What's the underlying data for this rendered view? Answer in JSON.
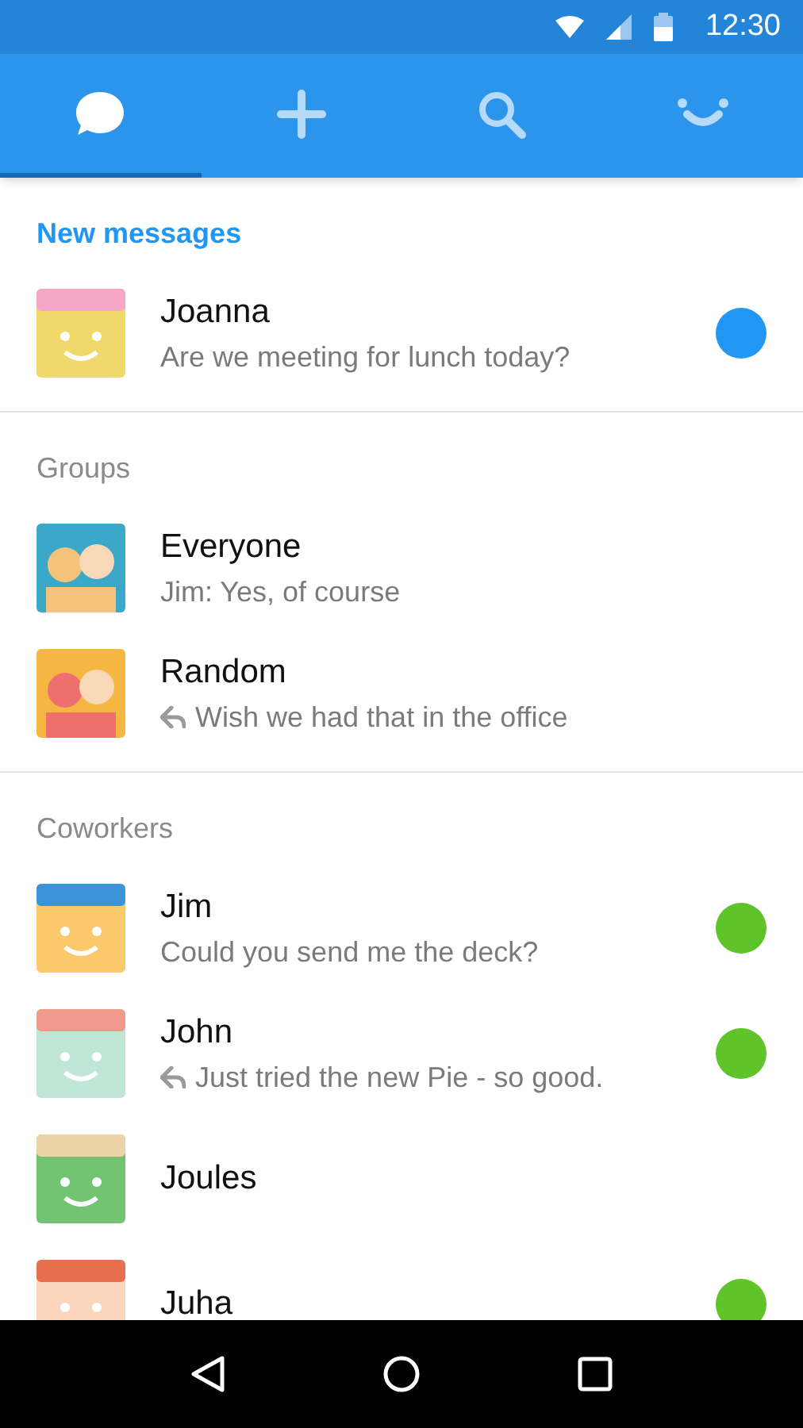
{
  "status_bar": {
    "time": "12:30"
  },
  "tabs": [
    {
      "kind": "chat",
      "selected": true
    },
    {
      "kind": "add",
      "selected": false
    },
    {
      "kind": "search",
      "selected": false
    },
    {
      "kind": "smile",
      "selected": false
    }
  ],
  "sections": [
    {
      "title": "New messages",
      "highlighted": true,
      "items": [
        {
          "name": "Joanna",
          "message": "Are we meeting for lunch today?",
          "replied": false,
          "color": "#2196f3"
        }
      ]
    },
    {
      "title": "Groups",
      "highlighted": false,
      "items": [
        {
          "name": "Everyone",
          "message": "Jim: Yes, of course",
          "replied": false
        },
        {
          "name": "Random",
          "message": "Wish we had that in the office",
          "replied": true
        }
      ]
    },
    {
      "title": "Coworkers",
      "highlighted": false,
      "items": [
        {
          "name": "Jim",
          "message": "Could you send me the deck?",
          "replied": false,
          "color": "#5ec42a"
        },
        {
          "name": "John",
          "message": "Just tried the new Pie - so good.",
          "replied": true,
          "color": "#5ec42a"
        },
        {
          "name": "Joules"
        },
        {
          "name": "Juha",
          "color": "#5ec42a"
        }
      ]
    }
  ]
}
